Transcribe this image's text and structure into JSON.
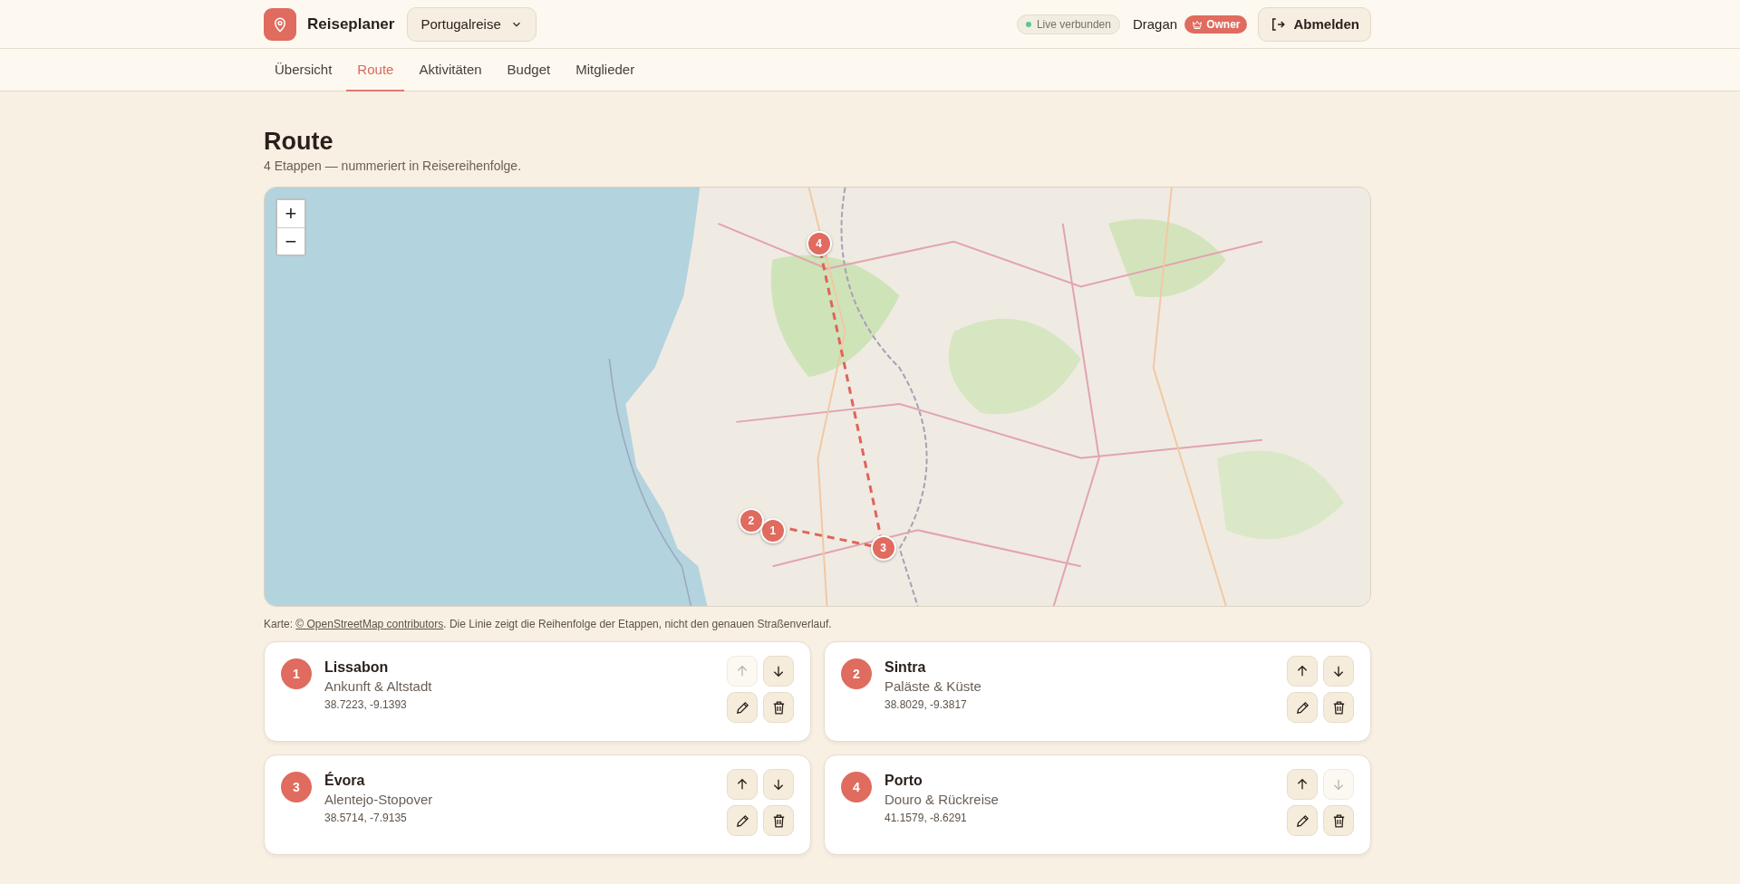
{
  "header": {
    "app_name": "Reiseplaner",
    "trip_selector": "Portugalreise",
    "connection_status": "Live verbunden",
    "user_name": "Dragan",
    "role_badge": "Owner",
    "logout_button": "Abmelden"
  },
  "tabs": [
    {
      "label": "Übersicht",
      "selected": false
    },
    {
      "label": "Route",
      "selected": true
    },
    {
      "label": "Aktivitäten",
      "selected": false
    },
    {
      "label": "Budget",
      "selected": false
    },
    {
      "label": "Mitglieder",
      "selected": false
    }
  ],
  "page": {
    "title": "Route",
    "subtitle": "4 Etappen — nummeriert in Reisereihenfolge."
  },
  "map": {
    "kind": "picture",
    "zoom_in": "+",
    "zoom_out": "−"
  },
  "caption": {
    "prefix": "Karte: ",
    "link": "© OpenStreetMap contributors",
    "suffix": ". Die Linie zeigt die Reihenfolge der Etappen, nicht den genauen Straßenverlauf."
  },
  "stops": [
    {
      "number": "1",
      "name": "Lissabon",
      "description": "Ankunft & Altstadt",
      "coordinates": "38.7223, -9.1393",
      "map_marker": "1",
      "up_disabled": true,
      "down_disabled": false
    },
    {
      "number": "2",
      "name": "Sintra",
      "description": "Paläste & Küste",
      "coordinates": "38.8029, -9.3817",
      "map_marker": "2",
      "up_disabled": false,
      "down_disabled": false
    },
    {
      "number": "3",
      "name": "Évora",
      "description": "Alentejo-Stopover",
      "coordinates": "38.5714, -7.9135",
      "map_marker": "3",
      "up_disabled": false,
      "down_disabled": false
    },
    {
      "number": "4",
      "name": "Porto",
      "description": "Douro & Rückreise",
      "coordinates": "41.1579, -8.6291",
      "map_marker": "4",
      "up_disabled": false,
      "down_disabled": true
    }
  ]
}
